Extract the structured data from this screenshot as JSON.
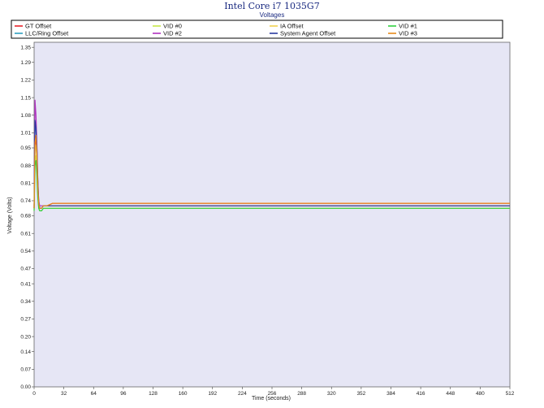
{
  "chart_data": {
    "type": "line",
    "title": "Intel Core i7 1035G7",
    "subtitle": "Voltages",
    "xlabel": "Time (seconds)",
    "ylabel": "Voltage (Volts)",
    "xlim": [
      0,
      512
    ],
    "ylim": [
      0,
      1.37
    ],
    "xticks": [
      "0",
      "32",
      "64",
      "96",
      "128",
      "160",
      "192",
      "224",
      "256",
      "288",
      "320",
      "352",
      "384",
      "416",
      "448",
      "480",
      "512"
    ],
    "yticks": [
      "0.00",
      "0.07",
      "0.14",
      "0.20",
      "0.27",
      "0.34",
      "0.41",
      "0.47",
      "0.54",
      "0.61",
      "0.68",
      "0.74",
      "0.81",
      "0.88",
      "0.95",
      "1.01",
      "1.08",
      "1.15",
      "1.22",
      "1.29",
      "1.35"
    ],
    "grid": false,
    "legend_position": "top",
    "series": [
      {
        "name": "GT Offset",
        "color": "#e8232a",
        "x": [
          0,
          1,
          2,
          3,
          4,
          5,
          6,
          8,
          10,
          14,
          20,
          32,
          64,
          96,
          128,
          160,
          192,
          224,
          256,
          288,
          320,
          352,
          384,
          416,
          448,
          480,
          512
        ],
        "y": [
          0.71,
          0.96,
          0.99,
          0.92,
          0.8,
          0.73,
          0.71,
          0.71,
          0.72,
          0.72,
          0.73,
          0.73,
          0.73,
          0.73,
          0.73,
          0.73,
          0.73,
          0.73,
          0.73,
          0.73,
          0.73,
          0.73,
          0.73,
          0.73,
          0.73,
          0.73,
          0.73
        ]
      },
      {
        "name": "LLC/Ring Offset",
        "color": "#2f9fbf",
        "x": [
          0,
          1,
          2,
          3,
          4,
          5,
          6,
          8,
          10,
          14,
          20,
          32,
          64,
          96,
          128,
          160,
          192,
          224,
          256,
          288,
          320,
          352,
          384,
          416,
          448,
          480,
          512
        ],
        "y": [
          0.71,
          1.04,
          1.02,
          0.95,
          0.82,
          0.74,
          0.71,
          0.71,
          0.72,
          0.72,
          0.72,
          0.72,
          0.72,
          0.72,
          0.72,
          0.72,
          0.72,
          0.72,
          0.72,
          0.72,
          0.72,
          0.72,
          0.72,
          0.72,
          0.72,
          0.72,
          0.72
        ]
      },
      {
        "name": "VID #0",
        "color": "#c7e84a",
        "x": [
          0,
          1,
          2,
          3,
          4,
          5,
          6,
          8,
          10,
          14,
          20,
          32,
          64,
          96,
          128,
          160,
          192,
          224,
          256,
          288,
          320,
          352,
          384,
          416,
          448,
          480,
          512
        ],
        "y": [
          0.7,
          0.9,
          0.92,
          0.86,
          0.76,
          0.71,
          0.7,
          0.7,
          0.71,
          0.71,
          0.71,
          0.71,
          0.71,
          0.71,
          0.71,
          0.71,
          0.71,
          0.71,
          0.71,
          0.71,
          0.71,
          0.71,
          0.71,
          0.71,
          0.71,
          0.71,
          0.71
        ]
      },
      {
        "name": "VID #2",
        "color": "#b030c0",
        "x": [
          0,
          1,
          2,
          3,
          4,
          5,
          6,
          8,
          10,
          14,
          20,
          32,
          64,
          96,
          128,
          160,
          192,
          224,
          256,
          288,
          320,
          352,
          384,
          416,
          448,
          480,
          512
        ],
        "y": [
          0.72,
          1.14,
          1.08,
          0.97,
          0.82,
          0.74,
          0.72,
          0.72,
          0.72,
          0.72,
          0.72,
          0.72,
          0.72,
          0.72,
          0.72,
          0.72,
          0.72,
          0.72,
          0.72,
          0.72,
          0.72,
          0.72,
          0.72,
          0.72,
          0.72,
          0.72,
          0.72
        ]
      },
      {
        "name": "IA Offset",
        "color": "#f0d050",
        "x": [
          0,
          1,
          2,
          3,
          4,
          5,
          6,
          8,
          10,
          14,
          20,
          32,
          64,
          96,
          128,
          160,
          192,
          224,
          256,
          288,
          320,
          352,
          384,
          416,
          448,
          480,
          512
        ],
        "y": [
          0.71,
          0.94,
          0.96,
          0.9,
          0.78,
          0.72,
          0.71,
          0.71,
          0.72,
          0.72,
          0.72,
          0.72,
          0.72,
          0.72,
          0.72,
          0.72,
          0.72,
          0.72,
          0.72,
          0.72,
          0.72,
          0.72,
          0.72,
          0.72,
          0.72,
          0.72,
          0.72
        ]
      },
      {
        "name": "System Agent Offset",
        "color": "#2a3aa0",
        "x": [
          0,
          1,
          2,
          3,
          4,
          5,
          6,
          8,
          10,
          14,
          20,
          32,
          64,
          96,
          128,
          160,
          192,
          224,
          256,
          288,
          320,
          352,
          384,
          416,
          448,
          480,
          512
        ],
        "y": [
          0.71,
          1.06,
          1.03,
          0.95,
          0.81,
          0.73,
          0.71,
          0.71,
          0.72,
          0.72,
          0.72,
          0.72,
          0.72,
          0.72,
          0.72,
          0.72,
          0.72,
          0.72,
          0.72,
          0.72,
          0.72,
          0.72,
          0.72,
          0.72,
          0.72,
          0.72,
          0.72
        ]
      },
      {
        "name": "VID #1",
        "color": "#30d040",
        "x": [
          0,
          1,
          2,
          3,
          4,
          5,
          6,
          8,
          10,
          14,
          20,
          32,
          64,
          96,
          128,
          160,
          192,
          224,
          256,
          288,
          320,
          352,
          384,
          416,
          448,
          480,
          512
        ],
        "y": [
          0.7,
          0.88,
          0.9,
          0.84,
          0.75,
          0.71,
          0.7,
          0.7,
          0.71,
          0.71,
          0.71,
          0.71,
          0.71,
          0.71,
          0.71,
          0.71,
          0.71,
          0.71,
          0.71,
          0.71,
          0.71,
          0.71,
          0.71,
          0.71,
          0.71,
          0.71,
          0.71
        ]
      },
      {
        "name": "VID #3",
        "color": "#e88a1a",
        "x": [
          0,
          1,
          2,
          3,
          4,
          5,
          6,
          8,
          10,
          14,
          20,
          32,
          64,
          96,
          128,
          160,
          192,
          224,
          256,
          288,
          320,
          352,
          384,
          416,
          448,
          480,
          512
        ],
        "y": [
          0.71,
          0.97,
          1.0,
          0.93,
          0.8,
          0.73,
          0.71,
          0.71,
          0.72,
          0.72,
          0.73,
          0.73,
          0.73,
          0.73,
          0.73,
          0.73,
          0.73,
          0.73,
          0.73,
          0.73,
          0.73,
          0.73,
          0.73,
          0.73,
          0.73,
          0.73,
          0.73
        ]
      }
    ]
  }
}
